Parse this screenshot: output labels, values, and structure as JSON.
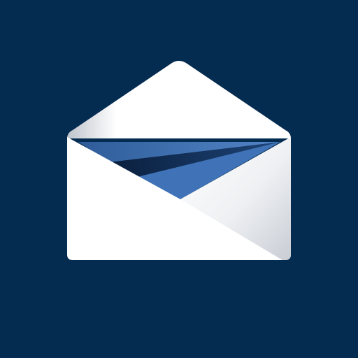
{
  "icon": {
    "name": "open-envelope-paper-plane-icon",
    "colors": {
      "background": "#042b50",
      "envelope": "#ffffff",
      "envelope_shadow": "#c7cbd2",
      "plane_light": "#4a7bbd",
      "plane_mid": "#3260a0",
      "plane_dark": "#0b2448"
    }
  }
}
